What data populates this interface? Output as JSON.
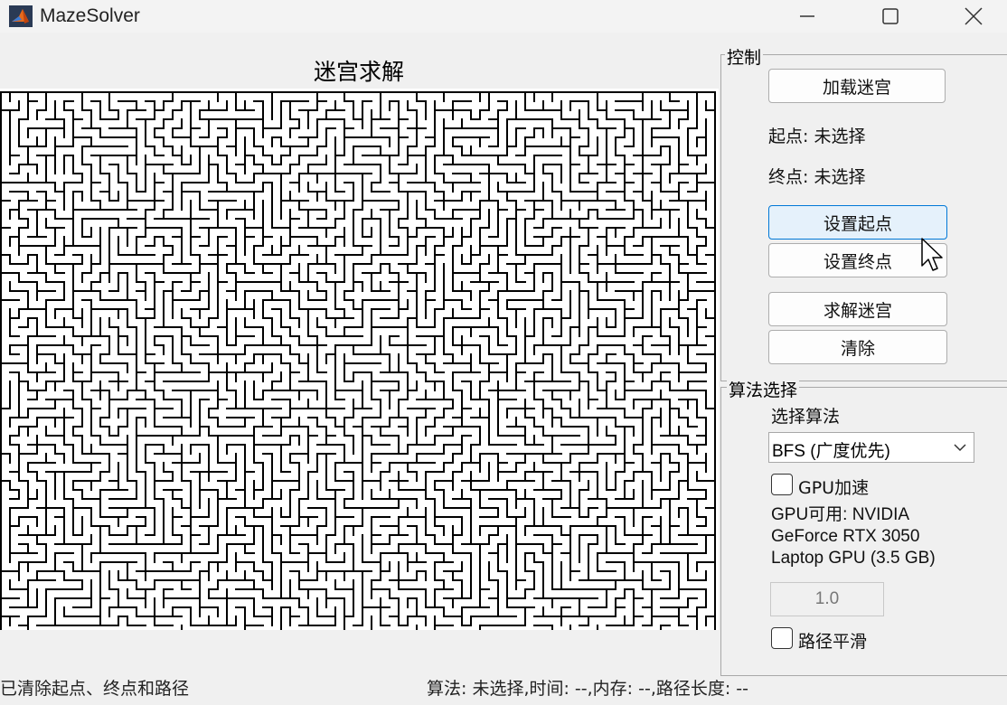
{
  "window": {
    "title": "MazeSolver",
    "icon": "matlab-icon",
    "controls": [
      "minimize-icon",
      "maximize-icon",
      "close-icon"
    ]
  },
  "plot": {
    "title": "迷宫求解"
  },
  "control_panel": {
    "title": "控制",
    "load_button": "加载迷宫",
    "start_label": "起点: 未选择",
    "end_label": "终点: 未选择",
    "set_start_button": "设置起点",
    "set_end_button": "设置终点",
    "solve_button": "求解迷宫",
    "clear_button": "清除"
  },
  "algorithm_panel": {
    "title": "算法选择",
    "select_label": "选择算法",
    "selected_algorithm": "BFS (广度优先)",
    "gpu_checkbox_label": "GPU加速",
    "gpu_checked": false,
    "gpu_info_lines": [
      "GPU可用: NVIDIA",
      "GeForce RTX 3050",
      "Laptop GPU (3.5 GB)"
    ],
    "smooth_value": "1.0",
    "smooth_checkbox_label": "路径平滑",
    "smooth_checked": false
  },
  "status": {
    "left": "已清除起点、终点和路径",
    "right": "算法: 未选择,时间: --,内存: --,路径长度: --"
  },
  "colors": {
    "hover_button_bg": "#e5f1fb",
    "hover_button_border": "#0078d7",
    "maze_wall": "#000000",
    "maze_bg": "#ffffff"
  }
}
